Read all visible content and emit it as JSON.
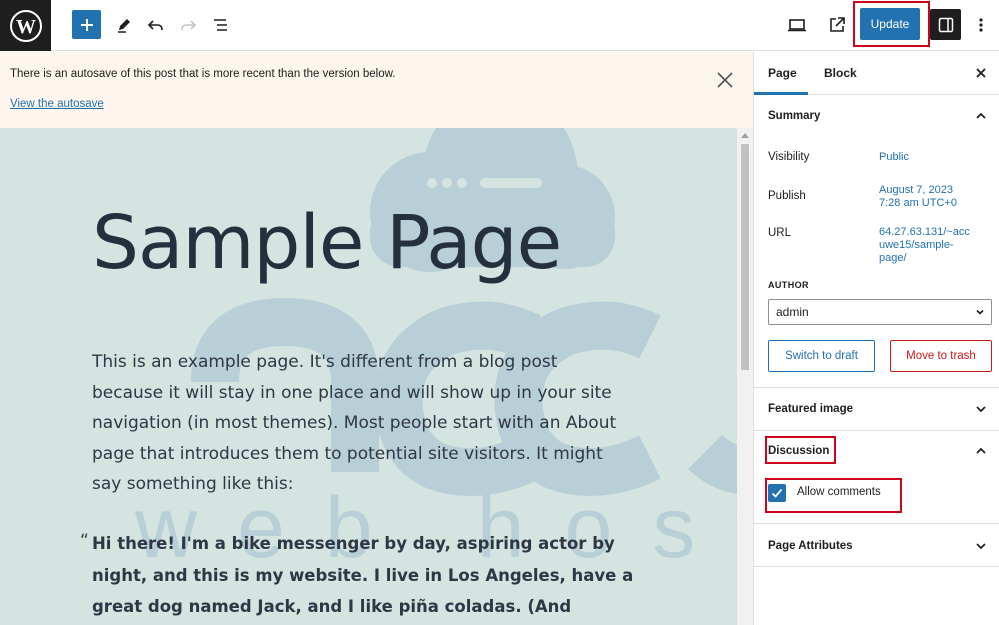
{
  "toolbar": {
    "update_label": "Update"
  },
  "notice": {
    "text": "There is an autosave of this post that is more recent than the version below.",
    "link": "View the autosave"
  },
  "editor": {
    "title": "Sample Page",
    "paragraph": "This is an example page. It's different from a blog post because it will stay in one place and will show up in your site navigation (in most themes). Most people start with an About page that introduces them to potential site visitors. It might say something like this:",
    "quote_mark": "“",
    "quote": "Hi there! I'm a bike messenger by day, aspiring actor by night, and this is my website. I live in Los Angeles, have a great dog named Jack, and I like piña coladas. (And gettin' caught in the"
  },
  "watermark": {
    "brand": "accu",
    "tagline": "web hosting"
  },
  "sidebar": {
    "tabs": [
      "Page",
      "Block"
    ],
    "summary": {
      "heading": "Summary",
      "visibility_label": "Visibility",
      "visibility_value": "Public",
      "publish_label": "Publish",
      "publish_value_line1": "August 7, 2023",
      "publish_value_line2": "7:28 am UTC+0",
      "url_label": "URL",
      "url_value_line1": "64.27.63.131/~acc",
      "url_value_line2": "uwe15/sample-",
      "url_value_line3": "page/",
      "author_label": "AUTHOR",
      "author_value": "admin",
      "switch_draft": "Switch to draft",
      "move_trash": "Move to trash"
    },
    "featured_image": "Featured image",
    "discussion": {
      "heading": "Discussion",
      "allow_comments": "Allow comments",
      "allow_comments_checked": true
    },
    "page_attributes": "Page Attributes"
  },
  "colors": {
    "accent": "#2271b1",
    "highlight": "#d0021b",
    "editor_bg": "#d4e4e1",
    "notice_bg": "#fef5ec"
  }
}
